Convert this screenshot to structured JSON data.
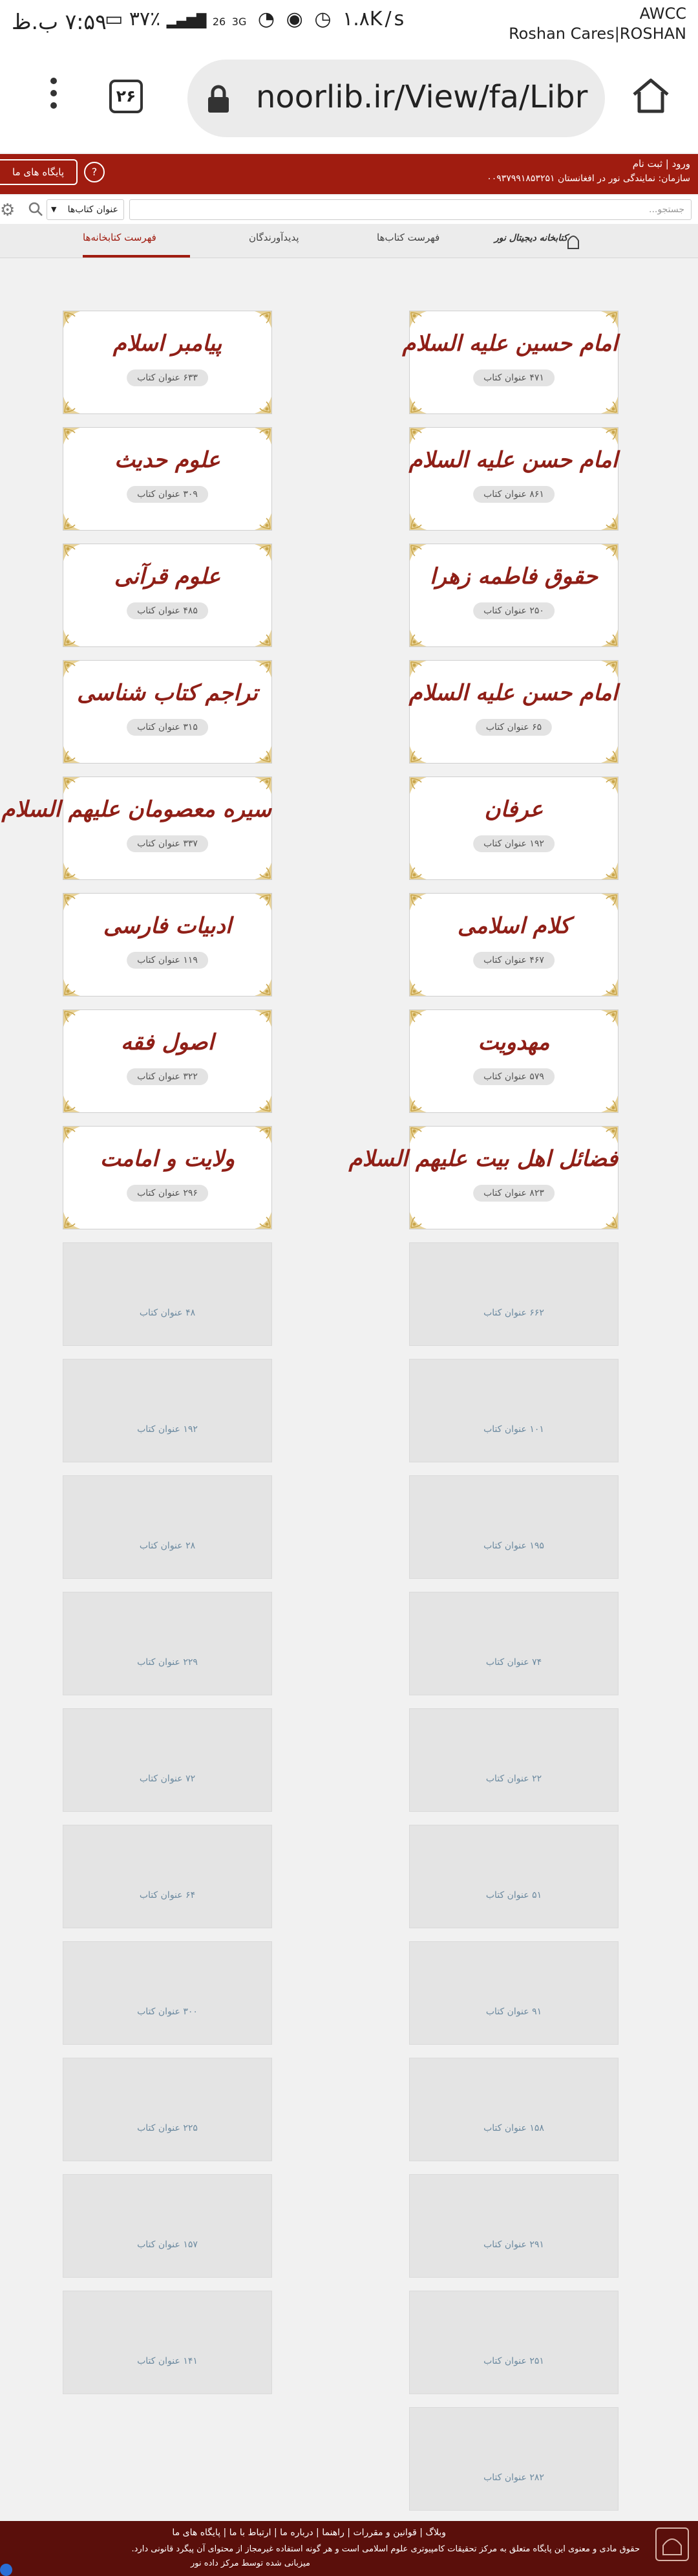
{
  "status_bar": {
    "time": "۷:۵۹ ب.ظ",
    "battery": "۳۷٪",
    "net_speed": "۱.۸K/s",
    "carrier_line1": "AWCC",
    "carrier_line2": "Roshan Cares|ROSHAN",
    "signal_1": "26",
    "signal_2": "3G"
  },
  "browser": {
    "tab_count": "۲۶",
    "url": "noorlib.ir/View/fa/Libr"
  },
  "site_header": {
    "our_libraries": "پایگاه های ما",
    "login": "ورود | ثبت نام",
    "org": "سازمان: نمایندگی نور در افغانستان ۰۰۹۳۷۹۹۱۸۵۳۲۵۱"
  },
  "search": {
    "placeholder": "جستجو...",
    "field_select": "عنوان کتاب‌ها"
  },
  "nav_tabs": {
    "libraries": "فهرست کتابخانه‌ها",
    "creators": "پدیدآورندگان",
    "books": "فهرست کتاب‌ها",
    "logo_text": "کتابخانه دیجیتال نور"
  },
  "libraries": [
    {
      "title": "امام حسین علیه السلام",
      "count": "۴۷۱ عنوان کتاب"
    },
    {
      "title": "پیامبر اسلام",
      "count": "۶۳۳ عنوان کتاب"
    },
    {
      "title": "امام حسن علیه السلام",
      "count": "۸۶۱ عنوان کتاب"
    },
    {
      "title": "علوم حدیث",
      "count": "۳۰۹ عنوان کتاب"
    },
    {
      "title": "حقوق فاطمه زهرا",
      "count": "۲۵۰ عنوان کتاب"
    },
    {
      "title": "علوم قرآنی",
      "count": "۴۸۵ عنوان کتاب"
    },
    {
      "title": "امام حسن علیه السلام",
      "count": "۶۵ عنوان کتاب"
    },
    {
      "title": "تراجم کتاب شناسی",
      "count": "۳۱۵ عنوان کتاب"
    },
    {
      "title": "عرفان",
      "count": "۱۹۲ عنوان کتاب"
    },
    {
      "title": "سیره معصومان علیهم السلام",
      "count": "۳۳۷ عنوان کتاب"
    },
    {
      "title": "کلام اسلامی",
      "count": "۴۶۷ عنوان کتاب"
    },
    {
      "title": "ادبیات فارسی",
      "count": "۱۱۹ عنوان کتاب"
    },
    {
      "title": "مهدویت",
      "count": "۵۷۹ عنوان کتاب"
    },
    {
      "title": "اصول فقه",
      "count": "۳۲۲ عنوان کتاب"
    },
    {
      "title": "فضائل اهل بیت علیهم السلام",
      "count": "۸۲۳ عنوان کتاب"
    },
    {
      "title": "ولایت و امامت",
      "count": "۲۹۶ عنوان کتاب"
    },
    {
      "title": "",
      "count": "۶۶۲ عنوان کتاب"
    },
    {
      "title": "",
      "count": "۴۸ عنوان کتاب"
    },
    {
      "title": "",
      "count": "۱۰۱ عنوان کتاب"
    },
    {
      "title": "",
      "count": "۱۹۲ عنوان کتاب"
    },
    {
      "title": "",
      "count": "۱۹۵ عنوان کتاب"
    },
    {
      "title": "",
      "count": "۲۸ عنوان کتاب"
    },
    {
      "title": "",
      "count": "۷۴ عنوان کتاب"
    },
    {
      "title": "",
      "count": "۲۲۹ عنوان کتاب"
    },
    {
      "title": "",
      "count": "۲۲ عنوان کتاب"
    },
    {
      "title": "",
      "count": "۷۲ عنوان کتاب"
    },
    {
      "title": "",
      "count": "۵۱ عنوان کتاب"
    },
    {
      "title": "",
      "count": "۶۴ عنوان کتاب"
    },
    {
      "title": "",
      "count": "۹۱ عنوان کتاب"
    },
    {
      "title": "",
      "count": "۳۰۰ عنوان کتاب"
    },
    {
      "title": "",
      "count": "۱۵۸ عنوان کتاب"
    },
    {
      "title": "",
      "count": "۲۲۵ عنوان کتاب"
    },
    {
      "title": "",
      "count": "۲۹۱ عنوان کتاب"
    },
    {
      "title": "",
      "count": "۱۵۷ عنوان کتاب"
    },
    {
      "title": "",
      "count": "۲۵۱ عنوان کتاب"
    },
    {
      "title": "",
      "count": "۱۴۱ عنوان کتاب"
    },
    {
      "title": "",
      "count": "۲۸۲ عنوان کتاب"
    }
  ],
  "footer": {
    "links": "وبلاگ | قوانین و مقررات | راهنما | درباره ما | ارتباط با ما | پایگاه های ما",
    "copyright": "حقوق مادی و معنوی این پایگاه متعلق به مرکز تحقیقات کامپیوتری علوم اسلامی است و هر گونه استفاده غیرمجاز از محتوای آن پیگرد قانونی دارد.",
    "host": "میزبانی شده توسط مرکز داده نور"
  },
  "colors": {
    "brand_red": "#a01c10",
    "footer": "#5a0f0b",
    "title_red": "#8f1f17"
  }
}
